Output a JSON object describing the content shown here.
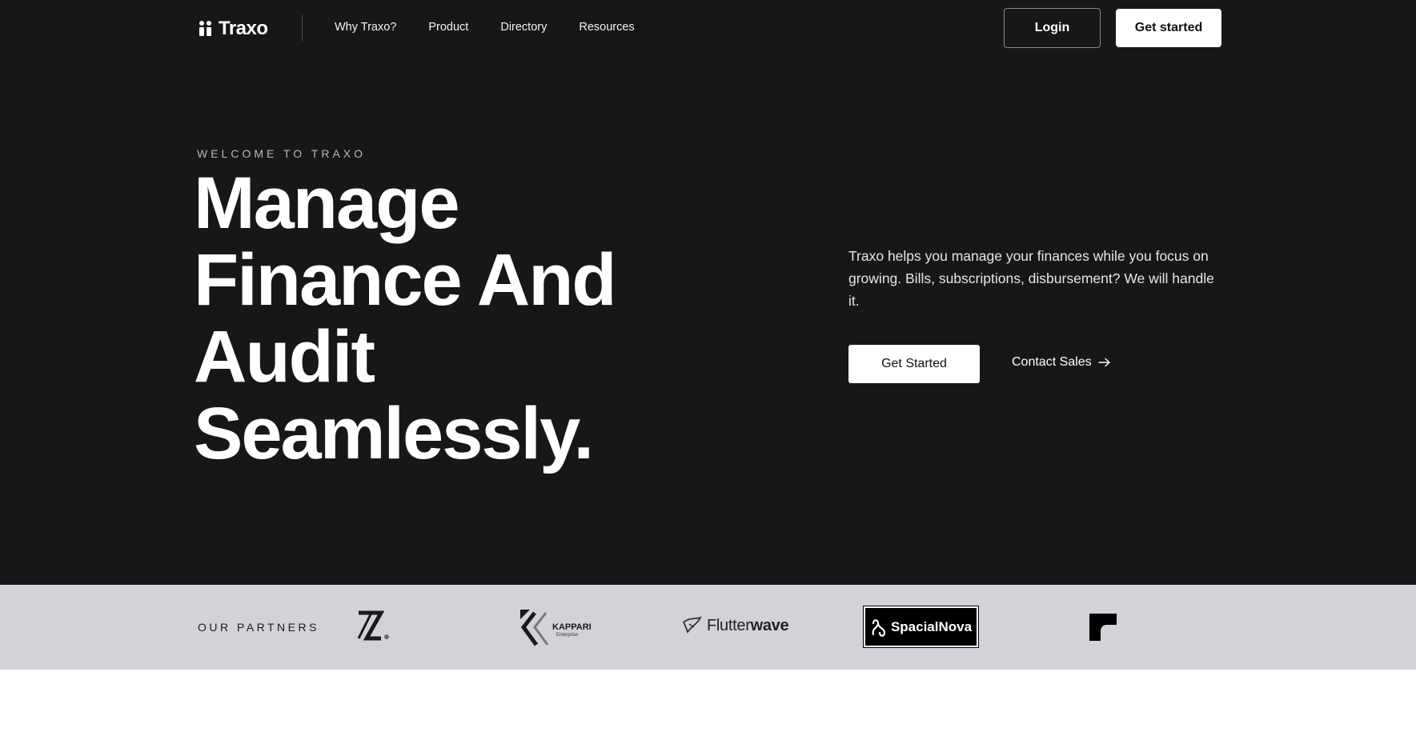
{
  "nav": {
    "logo_text": "Traxo",
    "links": [
      "Why Traxo?",
      "Product",
      "Directory",
      "Resources"
    ],
    "login_label": "Login",
    "get_started_label": "Get started"
  },
  "hero": {
    "eyebrow": "WELCOME TO TRAXO",
    "headline_lines": [
      "Manage",
      "Finance And",
      "Audit",
      "Seamlessly."
    ],
    "description": "Traxo helps you manage your finances while you focus on growing. Bills, subscriptions, disbursement? We will handle it.",
    "primary_cta": "Get Started",
    "secondary_cta": "Contact Sales"
  },
  "partners": {
    "label": "OUR PARTNERS",
    "logos": [
      {
        "name": "z-logo",
        "text": "Z."
      },
      {
        "name": "kappari-logo",
        "text": "KAPPARI",
        "subtext": "Enterprise"
      },
      {
        "name": "flutterwave-logo",
        "text_light": "Flutter",
        "text_bold": "wave"
      },
      {
        "name": "spacialnova-logo",
        "text": "SpacialNova"
      },
      {
        "name": "partner-mark-logo",
        "text": ""
      }
    ]
  },
  "colors": {
    "hero_bg": "#171719",
    "partners_bg": "#d1d3d8",
    "button_bg": "#ffffff"
  }
}
